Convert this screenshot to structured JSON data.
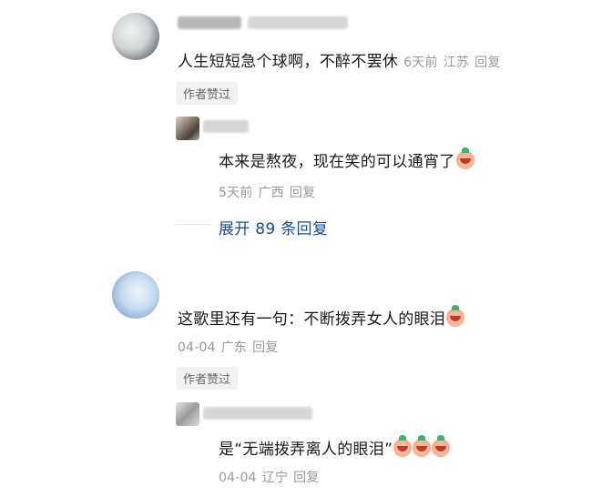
{
  "comments": [
    {
      "text": "人生短短急个球啊，不醉不罢休",
      "time": "6天前",
      "location": "江苏",
      "reply_label": "回复",
      "author_liked": "作者赞过",
      "replies": [
        {
          "text": "本来是熬夜，现在笑的可以通宵了",
          "emoji_count": 1,
          "time": "5天前",
          "location": "广西",
          "reply_label": "回复"
        }
      ],
      "expand_label": "展开 89 条回复"
    },
    {
      "text": "这歌里还有一句：不断拨弄女人的眼泪",
      "emoji_count": 1,
      "time": "04-04",
      "location": "广东",
      "reply_label": "回复",
      "author_liked": "作者赞过",
      "replies": [
        {
          "text": "是“无端拨弄离人的眼泪”",
          "emoji_count": 3,
          "time": "04-04",
          "location": "辽宁",
          "reply_label": "回复"
        }
      ]
    }
  ],
  "icons": [
    "crying-laughing-emoji-icon"
  ],
  "colors": {
    "link": "#1a4c8f",
    "meta": "#999999",
    "badge_bg": "#f2f2f2"
  }
}
